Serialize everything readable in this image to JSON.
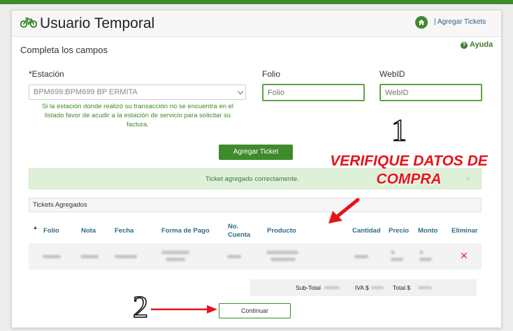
{
  "header": {
    "title": "Usuario Temporal",
    "agregar_tickets": "| Agregar Tickets"
  },
  "form": {
    "subtitle": "Completa los campos",
    "ayuda": "Ayuda",
    "estacion_label": "*Estación",
    "estacion_value": "BPM699:BPM699 BP ERMITA",
    "folio_label": "Folio",
    "folio_placeholder": "Folio",
    "webid_label": "WebID",
    "webid_placeholder": "WebID",
    "help_text": "Si la estación donde realizó su transacción no se encuentra en el listado favor de acudir a la estación de servicio para solicitar su factura.",
    "agregar_button": "Agregar Ticket"
  },
  "alert": {
    "message": "Ticket agregado correctamente.",
    "close": "×"
  },
  "tickets": {
    "panel_title": "Tickets Agregados",
    "sort_indicator": "▲",
    "columns": [
      "Folio",
      "Nota",
      "Fecha",
      "Forma de Pago",
      "No. Cuenta",
      "Producto",
      "Cantidad",
      "Precio",
      "Monto",
      "Eliminar"
    ],
    "delete_symbol": "✕"
  },
  "totals": {
    "subtotal_label": "Sub-Total",
    "iva_label": "IVA $",
    "total_label": "Total $"
  },
  "footer": {
    "continuar_button": "Continuar"
  },
  "annotations": {
    "step1": "1",
    "step2": "2",
    "callout": "VERIFIQUE DATOS DE COMPRA"
  },
  "colors": {
    "brand_green": "#3f8b2c",
    "annotation_red": "#e5141c",
    "delete_red": "#e0302c"
  }
}
